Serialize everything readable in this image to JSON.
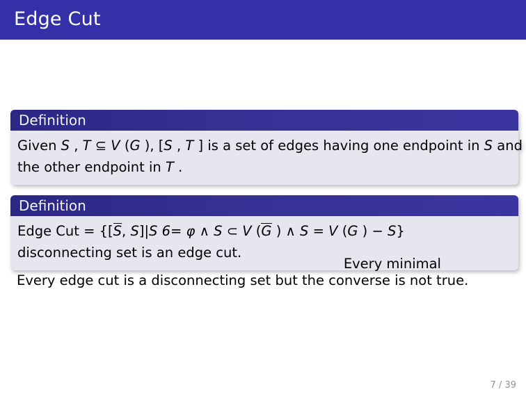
{
  "slide": {
    "title": "Edge Cut",
    "page_indicator": "7 / 39",
    "colors": {
      "title_bar": "#3330a8",
      "block_title": "#2b2785",
      "block_body": "#e6e6ef",
      "background": "#ffffff",
      "footer_text": "#8f8fa8"
    }
  },
  "blocks": [
    {
      "title": "Definition",
      "line1_a": "Given ",
      "line1_s": "S",
      "line1_b": " , ",
      "line1_t": "T",
      "line1_c": " ⊆ ",
      "line1_v": "V",
      "line1_d": " (",
      "line1_g": "G",
      "line1_e": " ), [",
      "line1_s2": "S",
      "line1_f": " , ",
      "line1_t2": "T",
      "line1_g2": " ] is a set of edges having one endpoint in ",
      "line1_s3": "S",
      "line1_h": " and",
      "line2_a": "the other endpoint in ",
      "line2_t": "T",
      "line2_b": " ."
    },
    {
      "title": "Definition",
      "line1_a": "Edge Cut = {[",
      "line1_sbar": "S",
      "line1_b": ", ",
      "line1_s": "S",
      "line1_c": "]|",
      "line1_s2": "S",
      "line1_d": " 6= ",
      "line1_phi": "φ",
      "line1_e": " ∧ ",
      "line1_s3": "S",
      "line1_f": " ⊂ ",
      "line1_v": "V",
      "line1_g": " (",
      "line1_gg": "G",
      "line1_h": " ) ∧ ",
      "line1_s4": "S",
      "line1_i": " = ",
      "line1_v2": "V",
      "line1_j": " (",
      "line1_g2": "G",
      "line1_k": " ) − ",
      "line1_s5": "S",
      "line1_l": "}",
      "overlap_text": "Every minimal",
      "line2": "disconnecting set is an edge cut."
    }
  ],
  "closing_line": "Every edge cut is a disconnecting set but the converse is not true."
}
